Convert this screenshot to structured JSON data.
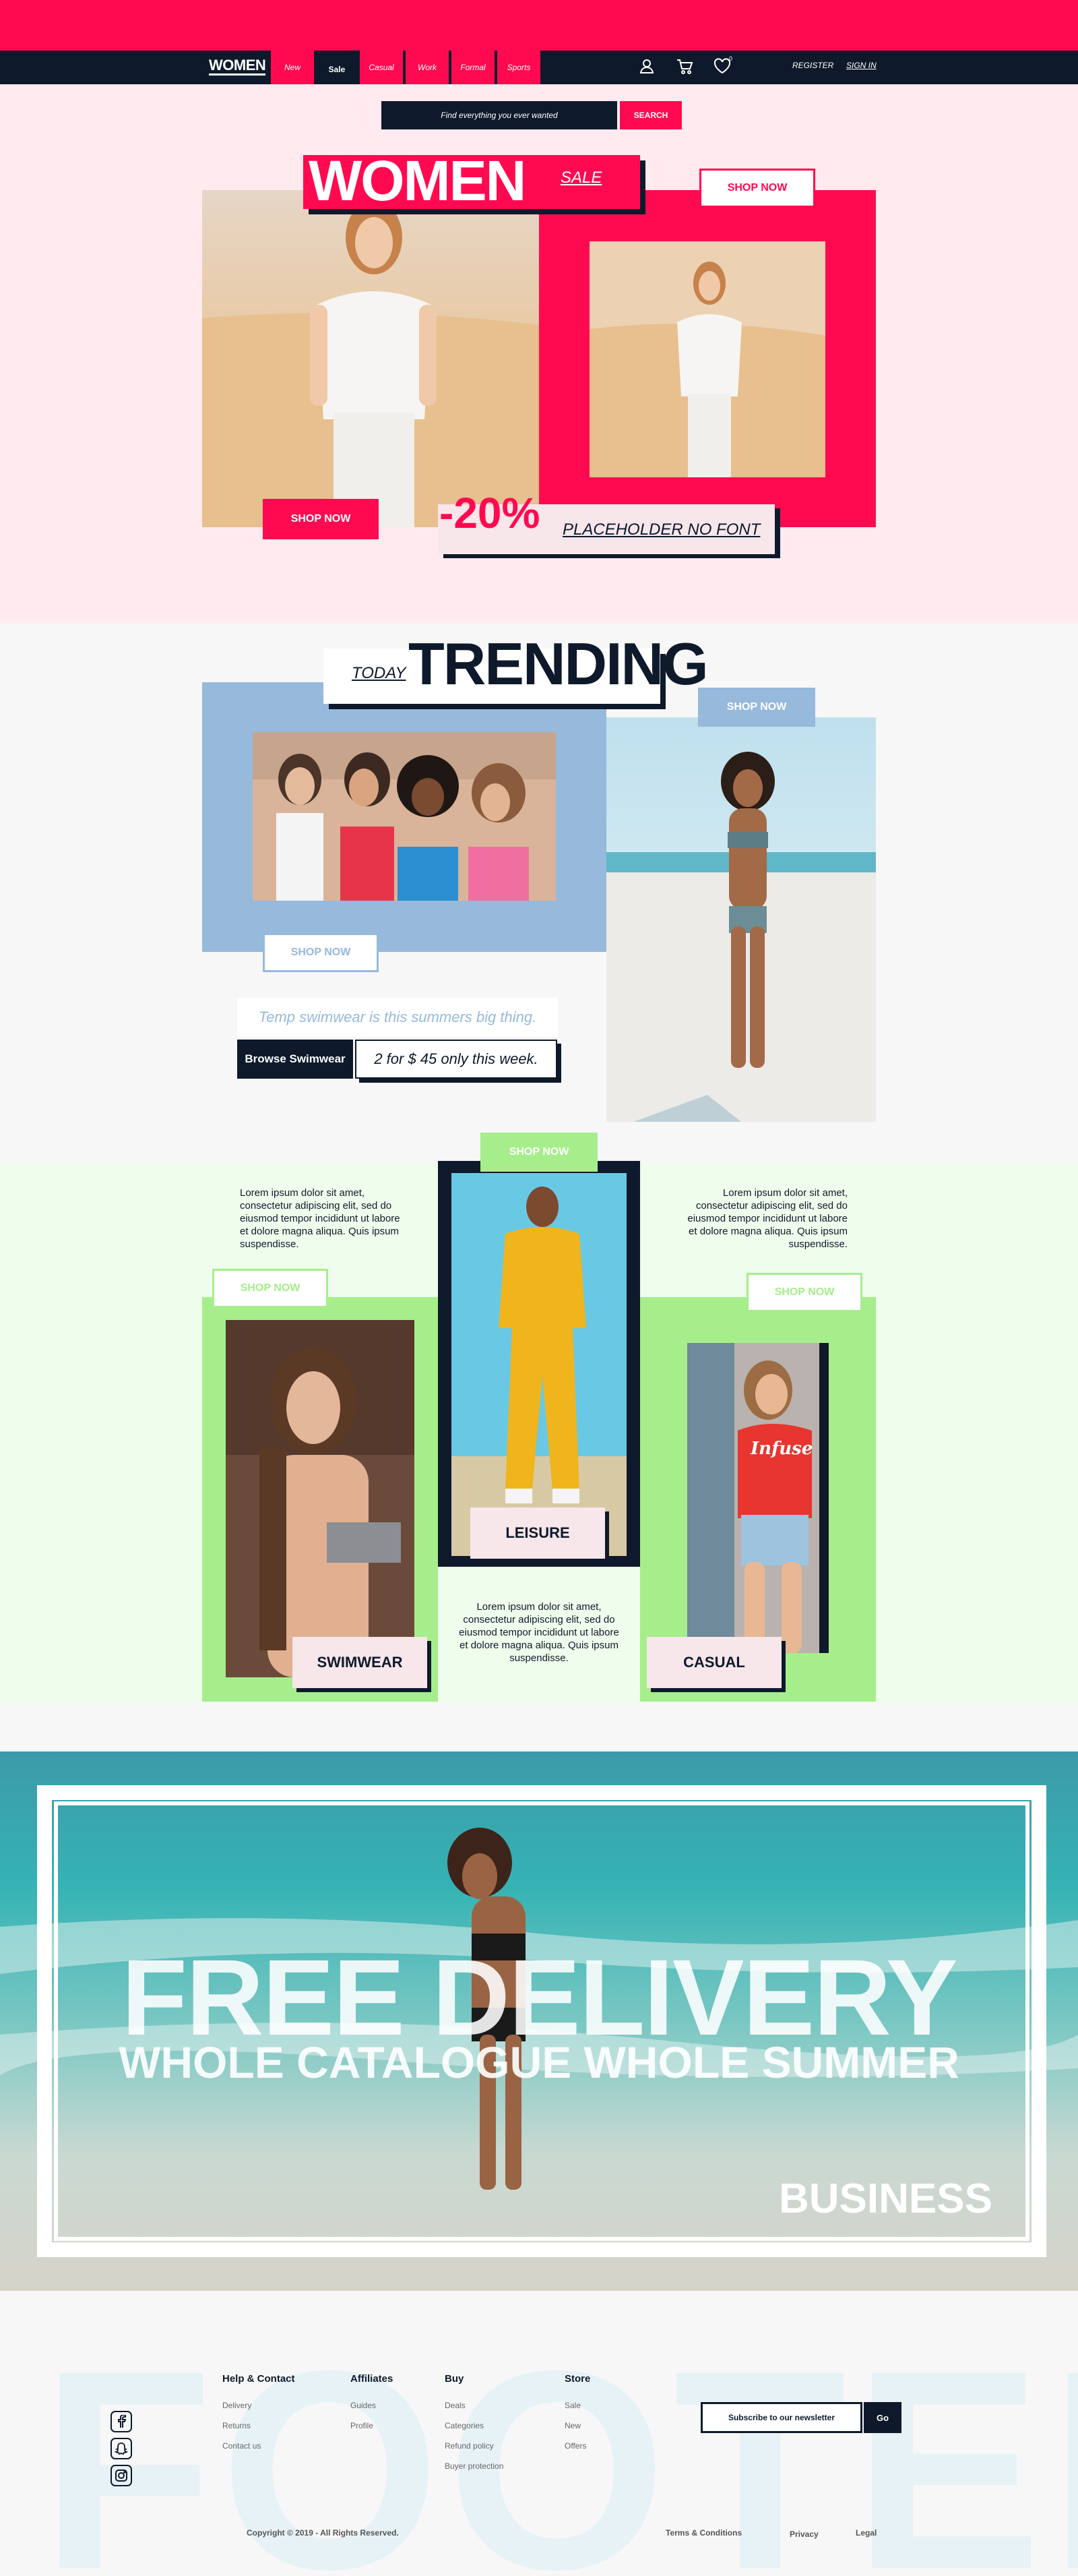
{
  "nav": {
    "brand": "WOMEN",
    "tabs": [
      {
        "label": "New"
      },
      {
        "label": "Sale"
      },
      {
        "label": "Casual"
      },
      {
        "label": "Work"
      },
      {
        "label": "Formal"
      },
      {
        "label": "Sports"
      }
    ],
    "register": "REGISTER",
    "sign_in": "SIGN IN",
    "icons": [
      "user-icon",
      "cart-icon",
      "heart-icon"
    ],
    "wishlist_count": "0"
  },
  "search": {
    "placeholder": "Find everything you ever wanted",
    "button": "SEARCH"
  },
  "hero": {
    "title": "WOMEN",
    "sale": "SALE",
    "shop_now_top": "SHOP NOW",
    "shop_now_bottom": "SHOP NOW",
    "discount": "-20%",
    "placeholder_text": "PLACEHOLDER NO FONT"
  },
  "trending": {
    "today": "TODAY",
    "title": "TRENDING",
    "shop_now_top": "SHOP NOW",
    "shop_now_bottom": "SHOP NOW",
    "tagline": "Temp swimwear is this summers big thing.",
    "browse": "Browse Swimwear",
    "offer": "2 for $ 45 only this week."
  },
  "categories": {
    "shop_now_center": "SHOP NOW",
    "shop_now_left": "SHOP NOW",
    "shop_now_right": "SHOP NOW",
    "lorem": "Lorem ipsum dolor sit amet, consectetur adipiscing elit, sed do eiusmod tempor incididunt ut labore et dolore magna aliqua. Quis ipsum suspendisse.",
    "swimwear": "SWIMWEAR",
    "leisure": "LEISURE",
    "casual": "CASUAL",
    "shirt_text": "Infuse"
  },
  "delivery": {
    "title": "FREE DELIVERY",
    "subtitle": "WHOLE CATALOGUE WHOLE SUMMER",
    "business": "BUSINESS"
  },
  "footer": {
    "watermark": "FOOTER",
    "columns": [
      {
        "title": "Help & Contact",
        "links": [
          "Delivery",
          "Returns",
          "Contact us"
        ]
      },
      {
        "title": "Affiliates",
        "links": [
          "Guides",
          "Profile"
        ]
      },
      {
        "title": "Buy",
        "links": [
          "Deals",
          "Categories",
          "Refund policy",
          "Buyer protection"
        ]
      },
      {
        "title": "Store",
        "links": [
          "Sale",
          "New",
          "Offers"
        ]
      }
    ],
    "newsletter": "Subscribe to our newsletter",
    "go": "Go",
    "copyright": "Copyright © 2019 - All Rights Reserved.",
    "terms": "Terms & Conditions",
    "privacy": "Privacy",
    "legal": "Legal",
    "socials": [
      "facebook-icon",
      "snapchat-icon",
      "instagram-icon"
    ]
  },
  "colors": {
    "accent": "#ff0a50",
    "navy": "#0e1a2b",
    "blue": "#96b9dc",
    "green": "#a6ee8b",
    "hero_bg": "#ffeaf0",
    "category_bg": "#effdec"
  }
}
